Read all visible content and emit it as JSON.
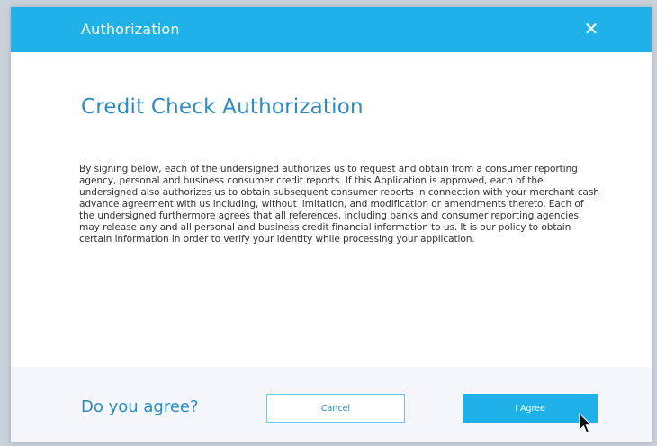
{
  "dialog": {
    "title": "Authorization",
    "close_icon": "close-icon",
    "heading": "Credit Check Authorization",
    "paragraph": "By signing below, each of the undersigned authorizes us to request and obtain from a consumer reporting agency, personal and business consumer credit reports. If this Application is approved, each of the undersigned also authorizes us to obtain subsequent consumer reports in connection with your merchant cash advance agreement with us including, without limitation, and modification or amendments thereto. Each of the undersigned furthermore agrees that all references, including banks and consumer reporting agencies, may release any and all personal and business credit financial information to us. It is our policy to obtain certain information in order to verify your identity while processing your application.",
    "question": "Do you agree?",
    "cancel_label": "Cancel",
    "agree_label": "I Agree"
  },
  "colors": {
    "accent": "#1eb2e8",
    "heading": "#2a8cc7",
    "footer_bg": "#f4f6f9"
  }
}
